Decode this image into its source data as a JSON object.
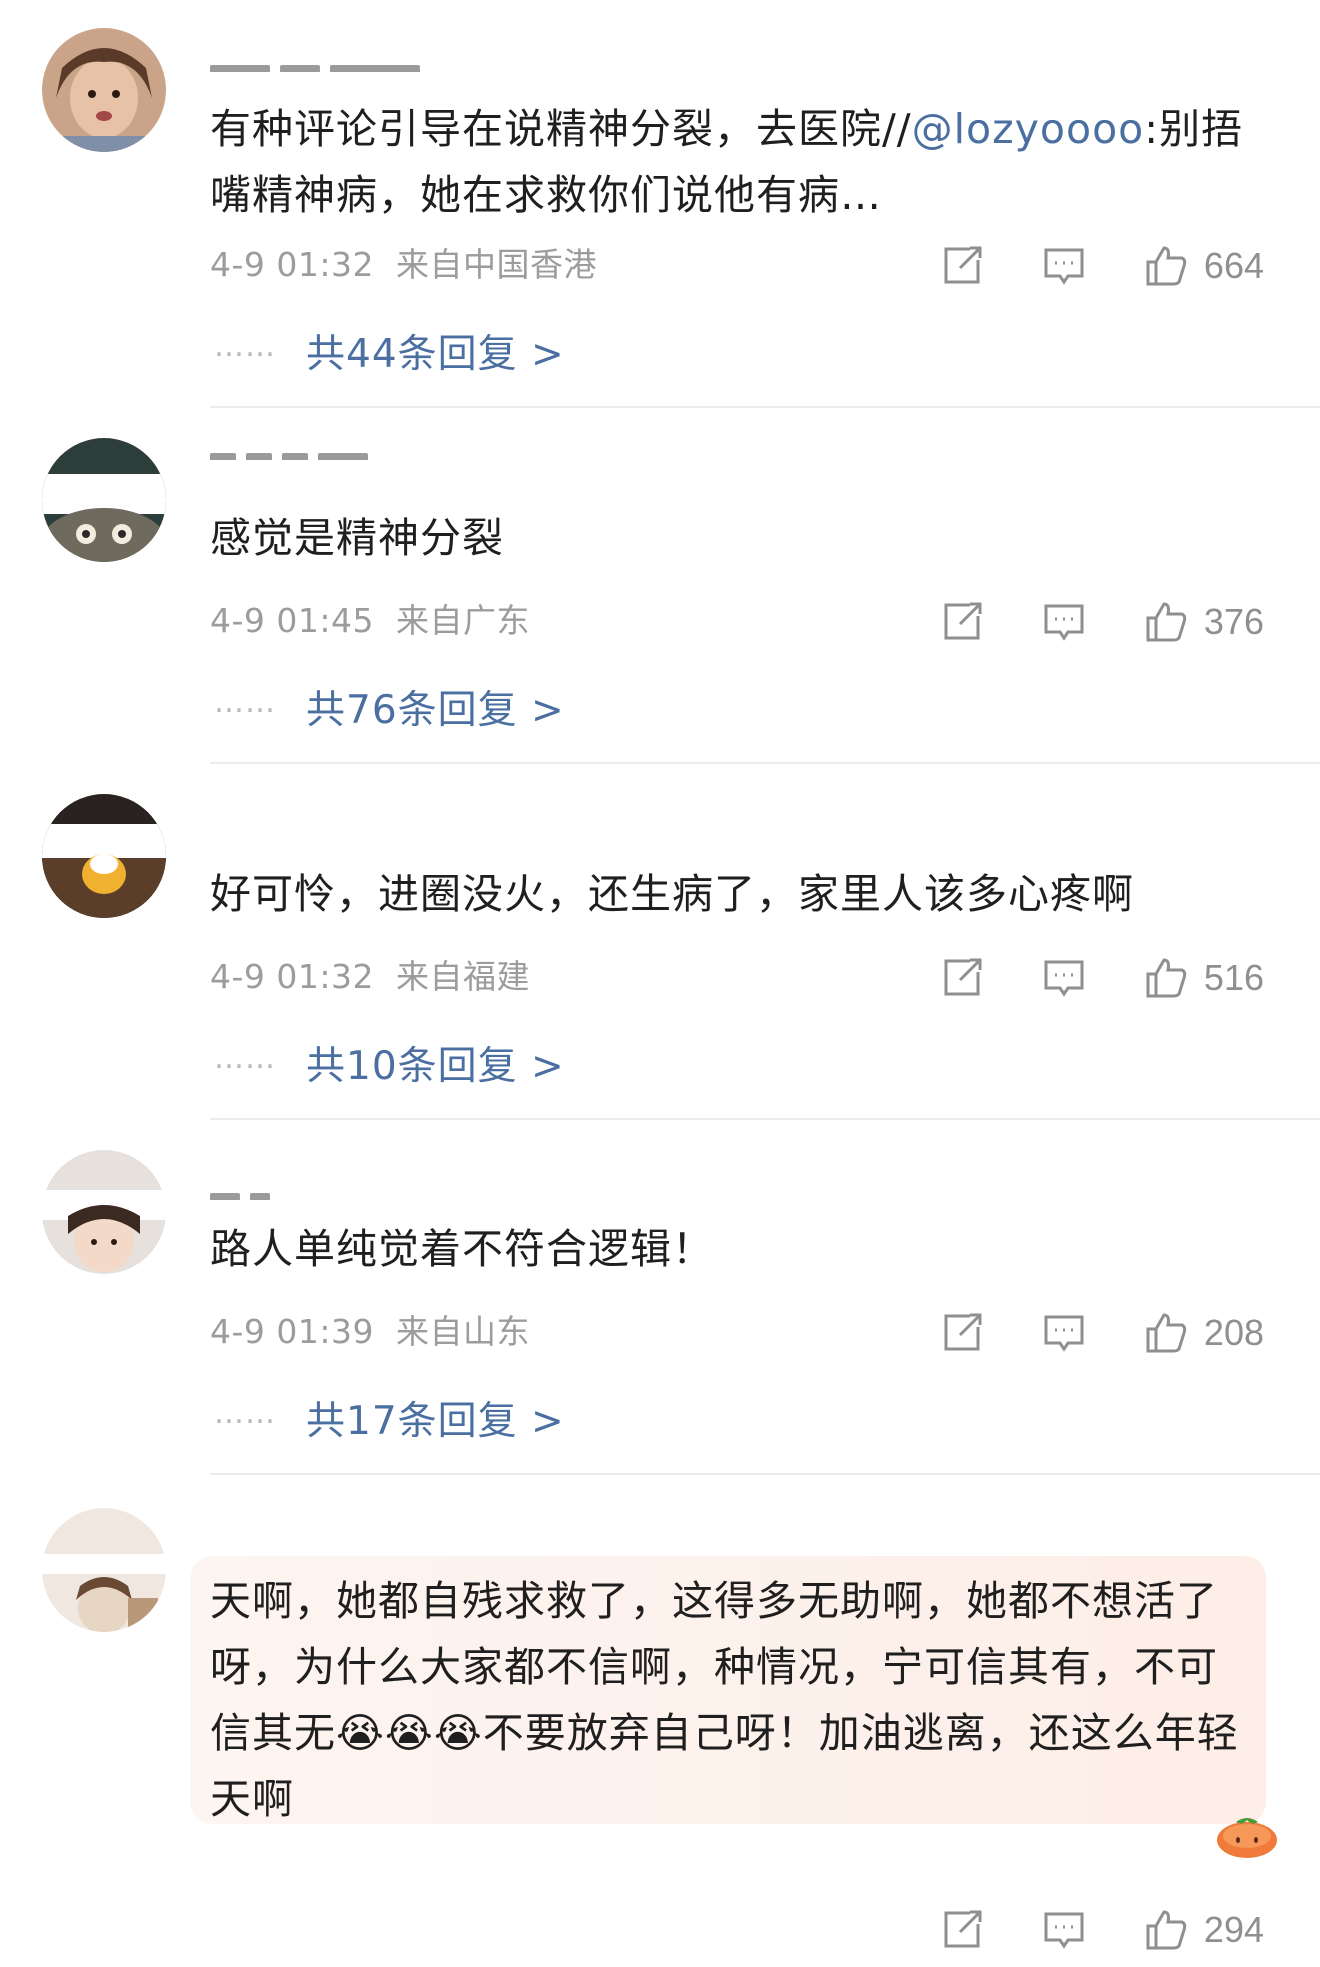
{
  "comments": [
    {
      "text": "有种评论引导在说精神分裂，去医院//",
      "mention": "@lozyoooo",
      "text_after": ":别捂嘴精神病，她在求救你们说他有病…",
      "time": "4-9 01:32",
      "location": "来自中国香港",
      "likes": "664",
      "replies": "共44条回复 >"
    },
    {
      "text": "感觉是精神分裂",
      "time": "4-9 01:45",
      "location": "来自广东",
      "likes": "376",
      "replies": "共76条回复 >"
    },
    {
      "text": "好可怜，进圈没火，还生病了，家里人该多心疼啊",
      "time": "4-9 01:32",
      "location": "来自福建",
      "likes": "516",
      "replies": "共10条回复 >"
    },
    {
      "text": "路人单纯觉着不符合逻辑！",
      "time": "4-9 01:39",
      "location": "来自山东",
      "likes": "208",
      "replies": "共17条回复 >"
    },
    {
      "text_part1": "天啊，她都自残求救了，这得多无助啊，她都不想活了呀，为什么大家都不信啊，种情况，宁可信其有，不可信其无",
      "emoji": "😭😭😭",
      "text_part2": "不要放弃自己呀！加油逃离，还这么年轻天啊",
      "likes": "294"
    }
  ],
  "reply_dots": "……",
  "icons": {
    "share": "share-icon",
    "comment": "comment-icon",
    "like": "thumbs-up-icon",
    "badge": "persimmon-icon"
  },
  "colors": {
    "link": "#4a6fa0",
    "meta": "#9c9c9c",
    "text": "#1f1f1f"
  }
}
